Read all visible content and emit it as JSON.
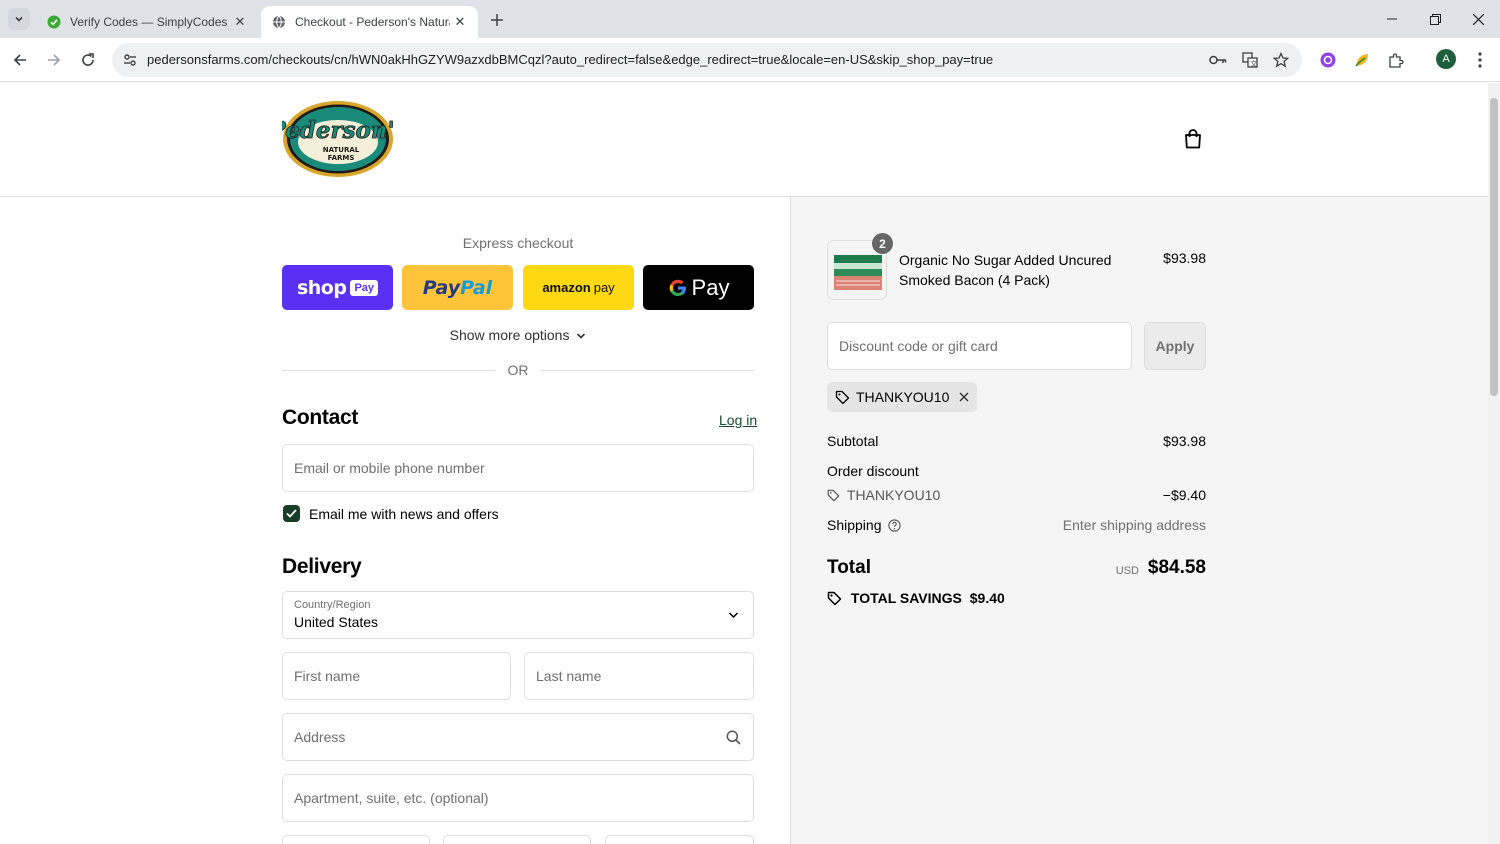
{
  "browser": {
    "tabs": [
      {
        "title": "Verify Codes — SimplyCodes",
        "active": false
      },
      {
        "title": "Checkout - Pederson's Natural F",
        "active": true
      }
    ],
    "url": "pedersonsfarms.com/checkouts/cn/hWN0akHhGZYW9azxdbBMCqzl?auto_redirect=false&edge_redirect=true&locale=en-US&skip_shop_pay=true",
    "profile_initial": "A"
  },
  "header": {
    "logo_text_main": "Pederson's",
    "logo_text_sub1": "NATURAL",
    "logo_text_sub2": "FARMS"
  },
  "express": {
    "title": "Express checkout",
    "buttons": {
      "shop_pay_1": "shop",
      "shop_pay_2": "Pay",
      "paypal_1": "Pay",
      "paypal_2": "Pal",
      "amazon_1": "amazon",
      "amazon_2": "pay",
      "gpay": "Pay"
    },
    "show_more": "Show more options",
    "or_text": "OR"
  },
  "contact": {
    "heading": "Contact",
    "login_label": "Log in",
    "email_placeholder": "Email or mobile phone number",
    "newsletter_label": "Email me with news and offers",
    "newsletter_checked": true
  },
  "delivery": {
    "heading": "Delivery",
    "country_label": "Country/Region",
    "country_value": "United States",
    "first_name_placeholder": "First name",
    "last_name_placeholder": "Last name",
    "address_placeholder": "Address",
    "apartment_placeholder": "Apartment, suite, etc. (optional)"
  },
  "summary": {
    "product": {
      "name": "Organic No Sugar Added Uncured Smoked Bacon (4 Pack)",
      "price": "$93.98",
      "quantity": "2"
    },
    "discount_placeholder": "Discount code or gift card",
    "apply_label": "Apply",
    "applied_code": "THANKYOU10",
    "subtotal_label": "Subtotal",
    "subtotal_value": "$93.98",
    "order_discount_label": "Order discount",
    "discount_code": "THANKYOU10",
    "discount_value": "−$9.40",
    "shipping_label": "Shipping",
    "shipping_value": "Enter shipping address",
    "total_label": "Total",
    "currency": "USD",
    "total_value": "$84.58",
    "savings_label": "TOTAL SAVINGS",
    "savings_value": "$9.40"
  },
  "colors": {
    "shop_pay": "#5a31f4",
    "paypal": "#ffc439",
    "amazon_pay": "#ffd814",
    "gpay": "#000000",
    "checkbox": "#1a3d2a",
    "logo_green": "#1a8a7a",
    "logo_gold": "#d9a52b"
  }
}
